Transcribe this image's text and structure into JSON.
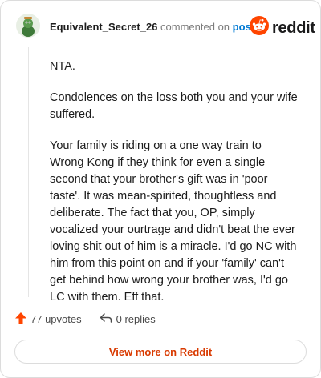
{
  "header": {
    "username": "Equivalent_Secret_26",
    "action_text": "commented on",
    "post_link": "post",
    "brand": "reddit"
  },
  "comment": {
    "paragraphs": [
      "NTA.",
      "Condolences on the loss both you and your wife suffered.",
      "Your family is riding on a one way train to Wrong Kong if they think for even a single second that your brother's gift was in 'poor taste'. It was mean-spirited, thoughtless and deliberate. The fact that you, OP, simply vocalized your ourtrage and didn't beat the ever loving shit out of him is a miracle. I'd go NC with him from this point on and if your 'family' can't get behind how wrong your brother was, I'd go LC with them. Eff that."
    ]
  },
  "footer": {
    "upvotes": "77 upvotes",
    "replies": "0 replies",
    "view_more": "View more on Reddit"
  },
  "colors": {
    "upvote": "#ff4500",
    "link": "#0079d3",
    "view_more": "#d93a00",
    "brand": "#ff4500"
  },
  "icons": {
    "upvote": "upvote-arrow-icon",
    "reply": "reply-arrow-icon",
    "brand": "reddit-snoo-icon"
  }
}
